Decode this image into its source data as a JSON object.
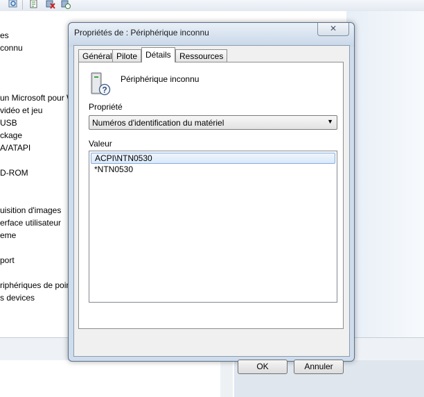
{
  "background": {
    "tree_items": [
      "es",
      "connu",
      "un Microsoft pour W",
      " vidéo et jeu",
      " USB",
      "ckage",
      "A/ATAPI",
      "D-ROM",
      "uisition d'images",
      "erface utilisateur",
      "eme",
      "port",
      "riphériques de poin",
      "s devices"
    ],
    "toolbar_icons": [
      "properties-icon",
      "update-driver-icon",
      "uninstall-icon",
      "scan-hardware-icon"
    ]
  },
  "dialog": {
    "title": "Propriétés de : Périphérique inconnu",
    "close_label": "✕",
    "tabs": [
      {
        "label": "Général",
        "active": false
      },
      {
        "label": "Pilote",
        "active": false
      },
      {
        "label": "Détails",
        "active": true
      },
      {
        "label": "Ressources",
        "active": false
      }
    ],
    "device_name": "Périphérique inconnu",
    "property_label": "Propriété",
    "property_selected": "Numéros d'identification du matériel",
    "value_label": "Valeur",
    "values": [
      "ACPI\\NTN0530",
      "*NTN0530"
    ],
    "ok_label": "OK",
    "cancel_label": "Annuler"
  },
  "colors": {
    "selection_border": "#84acdd",
    "frame": "#cfdceb"
  }
}
